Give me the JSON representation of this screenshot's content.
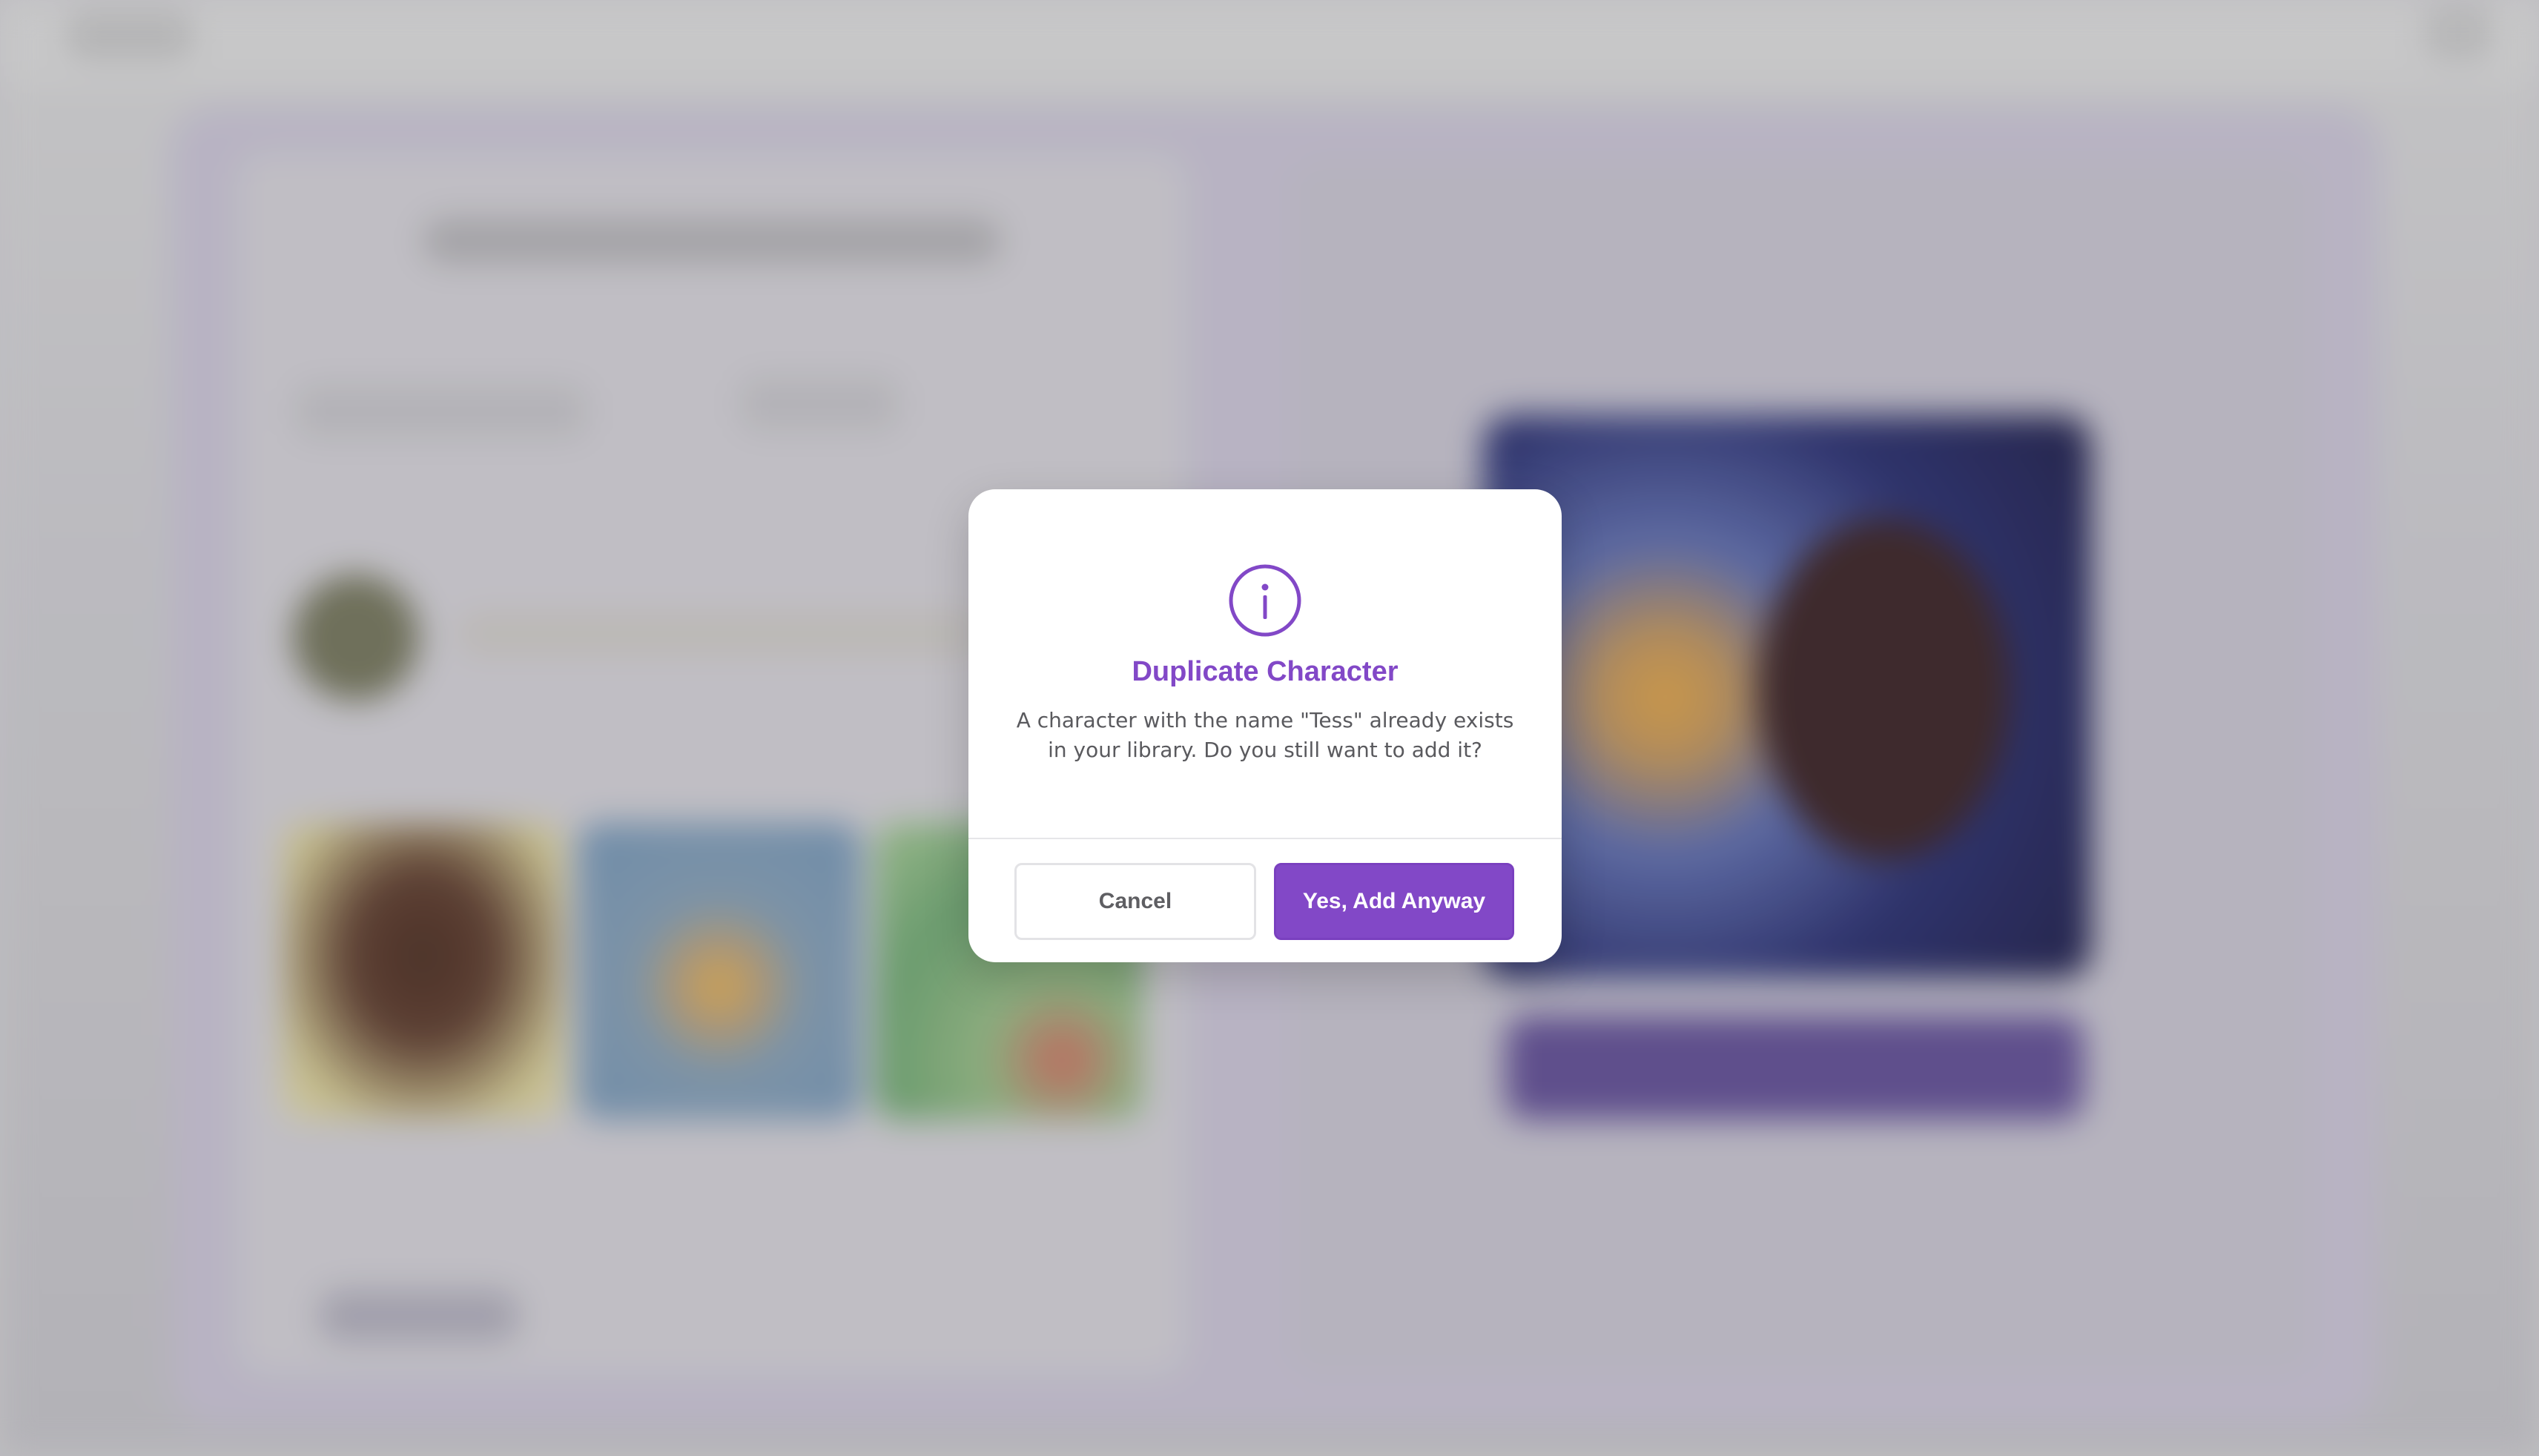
{
  "dialog": {
    "title": "Duplicate Character",
    "message": "A character with the name \"Tess\" already exists in your library. Do you still want to add it?",
    "icon": "info-circle-icon",
    "cancel_label": "Cancel",
    "confirm_label": "Yes, Add Anyway"
  },
  "colors": {
    "accent": "#8248c7",
    "text_muted": "#5a5a5e",
    "backdrop": "#c6c5c8"
  }
}
